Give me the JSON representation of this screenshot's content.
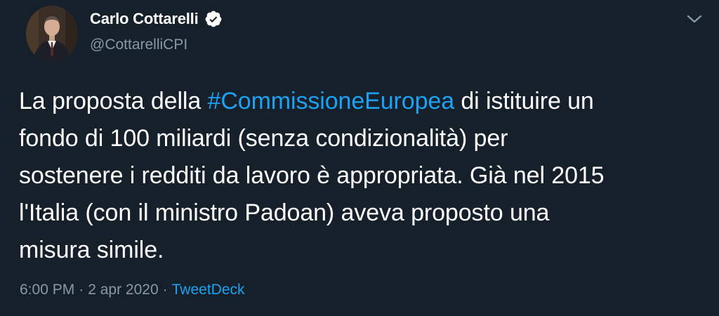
{
  "colors": {
    "background": "#15202b",
    "text": "#ffffff",
    "muted": "#8899a6",
    "accent": "#1da1f2"
  },
  "author": {
    "display_name": "Carlo Cottarelli",
    "handle": "@CottarelliCPI",
    "verified_icon": "verified-badge-icon",
    "avatar_icon": "profile-photo"
  },
  "menu_icon": "chevron-down-icon",
  "tweet": {
    "lines": [
      {
        "before": "La proposta della ",
        "hashtag": "#CommissioneEuropea",
        "after": " di istituire un"
      },
      {
        "text": "fondo di 100 miliardi (senza condizionalità) per"
      },
      {
        "text": "sostenere i redditi da lavoro è appropriata. Già nel 2015"
      },
      {
        "text": "l'Italia (con il ministro Padoan) aveva proposto una"
      },
      {
        "text": "misura simile."
      }
    ]
  },
  "meta": {
    "time": "6:00 PM",
    "separator": "·",
    "date": "2 apr 2020",
    "source": "TweetDeck"
  }
}
